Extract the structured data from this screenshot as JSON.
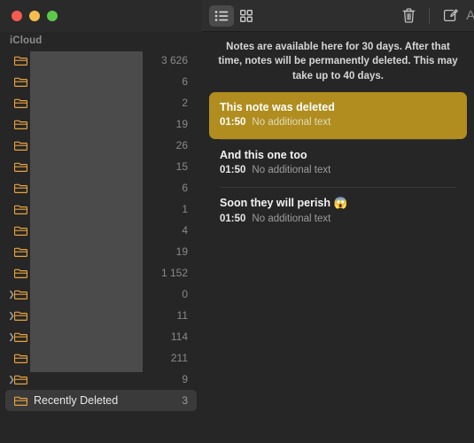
{
  "window": {
    "traffic_lights": [
      {
        "name": "close",
        "color": "#f45b51"
      },
      {
        "name": "minimize",
        "color": "#f5bd4f"
      },
      {
        "name": "zoom",
        "color": "#5bc84a"
      }
    ]
  },
  "sidebar": {
    "section_header": "iCloud",
    "folder_icon_color": "#e8a33d",
    "items": [
      {
        "label": "",
        "count": "3 626",
        "chevron": false,
        "selected": false,
        "redacted": true
      },
      {
        "label": "",
        "count": "6",
        "chevron": false,
        "selected": false,
        "redacted": true
      },
      {
        "label": "",
        "count": "2",
        "chevron": false,
        "selected": false,
        "redacted": true
      },
      {
        "label": "",
        "count": "19",
        "chevron": false,
        "selected": false,
        "redacted": true
      },
      {
        "label": "",
        "count": "26",
        "chevron": false,
        "selected": false,
        "redacted": true
      },
      {
        "label": "",
        "count": "15",
        "chevron": false,
        "selected": false,
        "redacted": true
      },
      {
        "label": "",
        "count": "6",
        "chevron": false,
        "selected": false,
        "redacted": true
      },
      {
        "label": "",
        "count": "1",
        "chevron": false,
        "selected": false,
        "redacted": true
      },
      {
        "label": "",
        "count": "4",
        "chevron": false,
        "selected": false,
        "redacted": true
      },
      {
        "label": "",
        "count": "19",
        "chevron": false,
        "selected": false,
        "redacted": true
      },
      {
        "label": "",
        "count": "1 152",
        "chevron": false,
        "selected": false,
        "redacted": true
      },
      {
        "label": "",
        "count": "0",
        "chevron": true,
        "selected": false,
        "redacted": true
      },
      {
        "label": "",
        "count": "11",
        "chevron": true,
        "selected": false,
        "redacted": true
      },
      {
        "label": "",
        "count": "114",
        "chevron": true,
        "selected": false,
        "redacted": true
      },
      {
        "label": "",
        "count": "211",
        "chevron": false,
        "selected": false,
        "redacted": true
      },
      {
        "label": "",
        "count": "9",
        "chevron": true,
        "selected": false,
        "redacted": true
      },
      {
        "label": "Recently Deleted",
        "count": "3",
        "chevron": false,
        "selected": true,
        "redacted": false
      }
    ]
  },
  "toolbar": {
    "list_view_label": "list-view",
    "gallery_view_label": "gallery-view",
    "delete_label": "delete",
    "compose_label": "compose",
    "format_label": "Aa"
  },
  "banner": {
    "text": "Notes are available here for 30 days. After that time, notes will be permanently deleted. This may take up to 40 days."
  },
  "notes": {
    "selected_color": "#b08d1e",
    "items": [
      {
        "title": "This note was deleted",
        "time": "01:50",
        "preview": "No additional text",
        "selected": true
      },
      {
        "title": "And this one too",
        "time": "01:50",
        "preview": "No additional text",
        "selected": false
      },
      {
        "title": "Soon they will perish 😱",
        "time": "01:50",
        "preview": "No additional text",
        "selected": false
      }
    ]
  }
}
